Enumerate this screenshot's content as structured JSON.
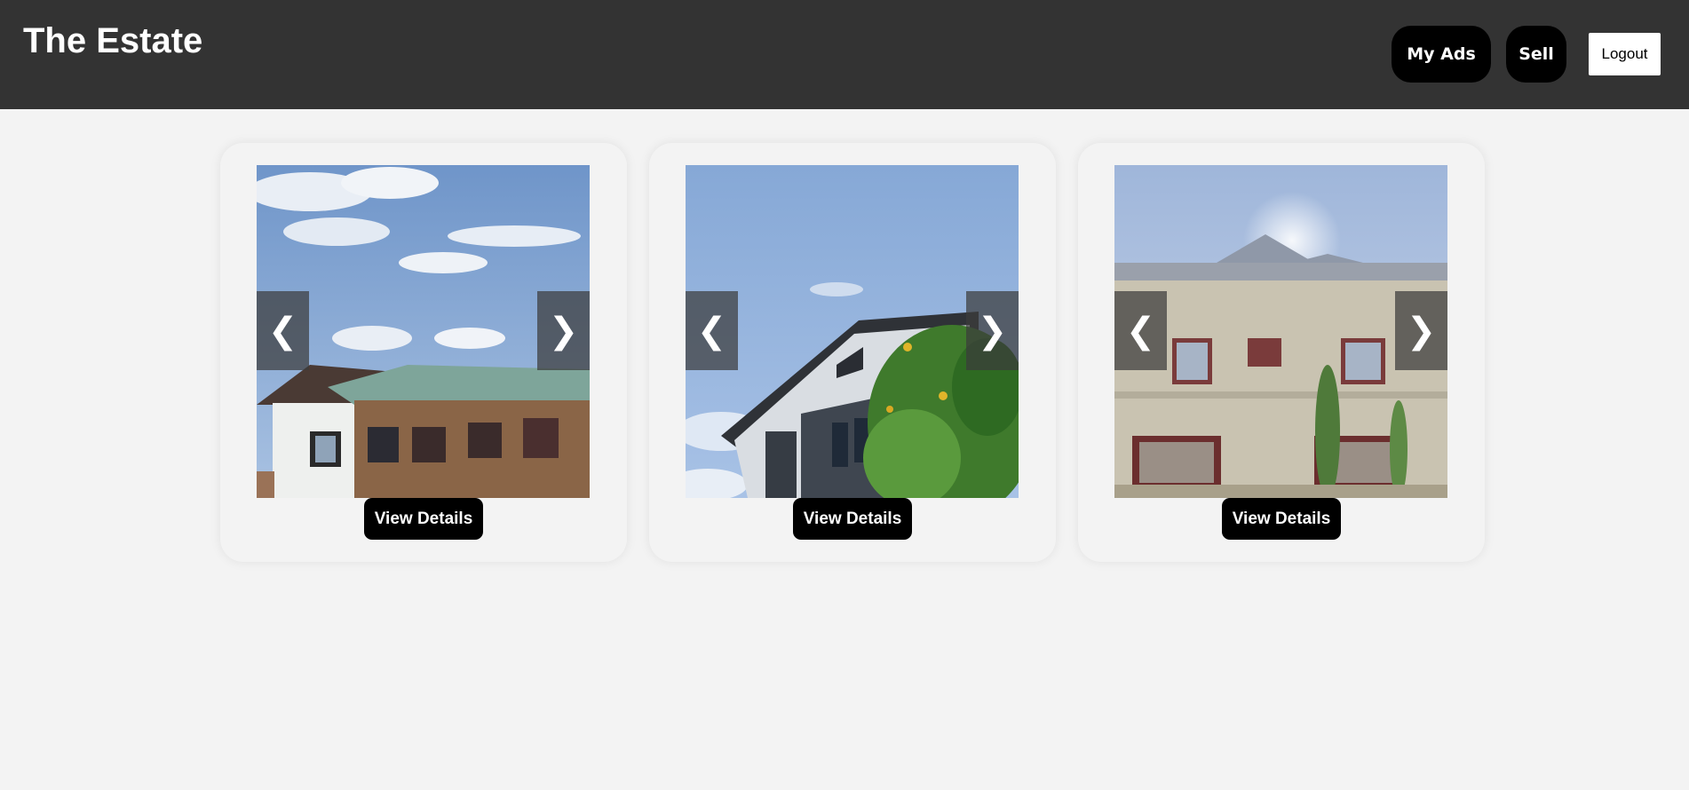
{
  "header": {
    "brand": "The Estate",
    "my_ads_label": "My Ads",
    "sell_label": "Sell",
    "logout_label": "Logout",
    "background": "#333333"
  },
  "listings": [
    {
      "prev_glyph": "❮",
      "next_glyph": "❯",
      "view_label": "View Details"
    },
    {
      "prev_glyph": "❮",
      "next_glyph": "❯",
      "view_label": "View Details"
    },
    {
      "prev_glyph": "❮",
      "next_glyph": "❯",
      "view_label": "View Details"
    }
  ],
  "colors": {
    "page_bg": "#f3f3f3",
    "button_bg": "#000000",
    "button_text": "#ffffff"
  }
}
